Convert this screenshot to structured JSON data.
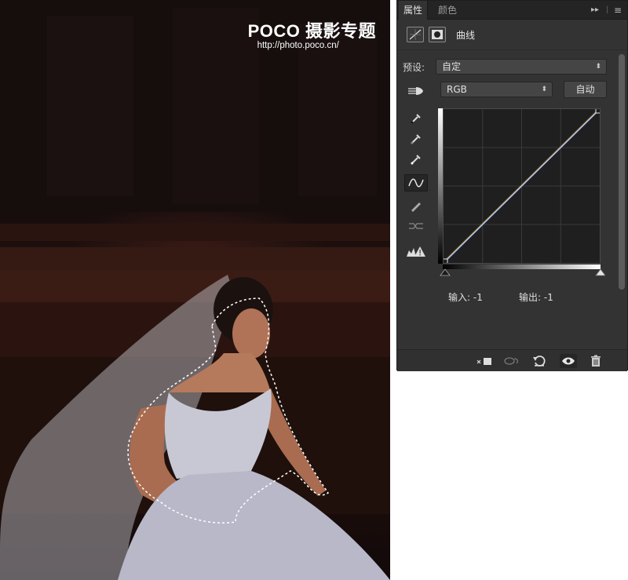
{
  "watermark": {
    "title": "POCO 摄影专题",
    "url": "http://photo.poco.cn/"
  },
  "panel": {
    "tabs": [
      {
        "label": "属性",
        "active": true
      },
      {
        "label": "颜色",
        "active": false
      }
    ],
    "tab_controls": {
      "collapse": "▸▸",
      "menu": "≡"
    },
    "adjustment": {
      "title": "曲线",
      "icons": [
        "curves-adjustment-icon",
        "layer-mask-icon"
      ]
    },
    "preset": {
      "label": "预设:",
      "value": "自定"
    },
    "channel": {
      "value": "RGB"
    },
    "auto_button": "自动",
    "tools": [
      "target-adjust-hand-icon",
      "black-point-eyedropper-icon",
      "gray-point-eyedropper-icon",
      "white-point-eyedropper-icon",
      "curve-points-icon",
      "pencil-draw-icon",
      "smooth-curve-icon",
      "clipping-warning-icon"
    ],
    "selected_tool": "curve-points-icon",
    "curve": {
      "points": [
        [
          0,
          0
        ],
        [
          255,
          255
        ]
      ],
      "channel_colors": {
        "rgb": "#d6d6d6",
        "red": "#c23a3a",
        "green": "#3aa84a",
        "blue": "#3a56c9"
      }
    },
    "input_label": "输入:",
    "input_value": "-1",
    "output_label": "输出:",
    "output_value": "-1",
    "footer_icons": [
      "clip-to-layer-icon",
      "view-previous-state-icon",
      "reset-icon",
      "visibility-eye-icon",
      "trash-icon"
    ]
  }
}
